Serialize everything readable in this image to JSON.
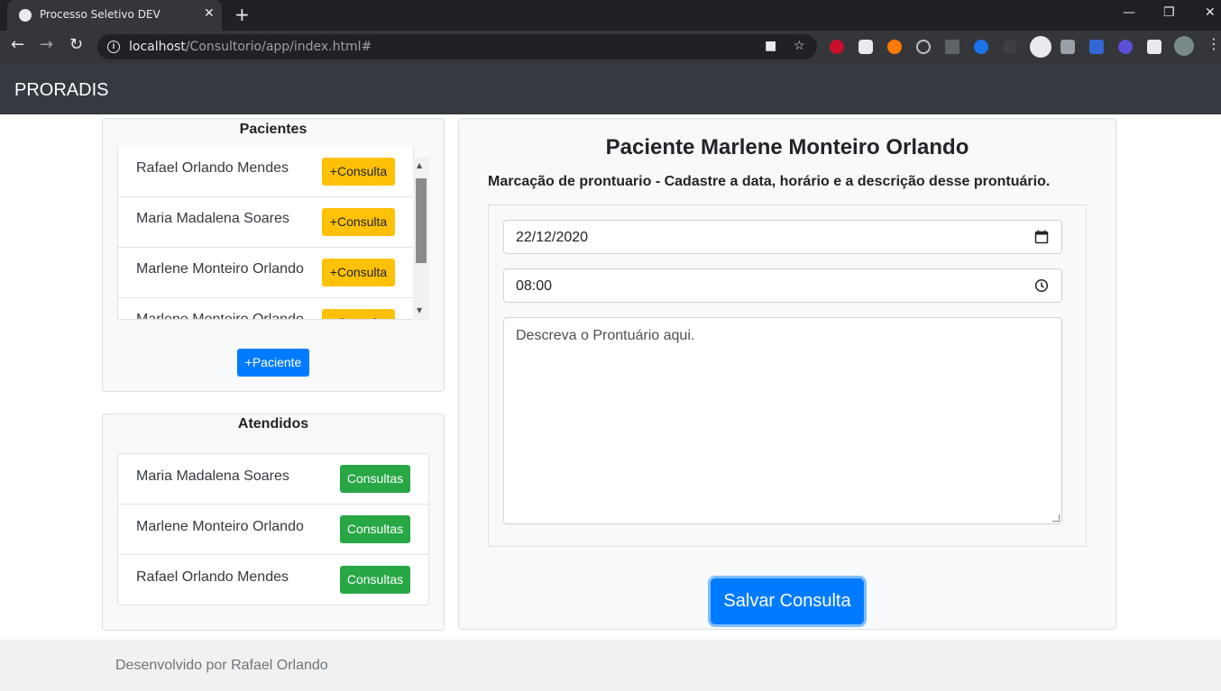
{
  "browser": {
    "tab_title": "Processo Seletivo DEV",
    "tab_close": "✕",
    "new_tab": "+",
    "url_host": "localhost",
    "url_path": "/Consultorio/app/index.html#",
    "nav_back": "←",
    "nav_forward": "→",
    "nav_reload": "↻",
    "win_minimize": "—",
    "win_restore": "❐",
    "win_close": "✕",
    "camera_icon": "■",
    "star_icon": "☆",
    "menu_icon": "⋮"
  },
  "navbar": {
    "brand": "PRORADIS"
  },
  "pacientes": {
    "title": "Pacientes",
    "items": [
      {
        "name": "Rafael Orlando Mendes",
        "action": "+Consulta"
      },
      {
        "name": "Maria Madalena Soares",
        "action": "+Consulta"
      },
      {
        "name": "Marlene Monteiro Orlando",
        "action": "+Consulta"
      },
      {
        "name": "Marlene Monteiro Orlando",
        "action": "+Consulta"
      }
    ],
    "add_button": "+Paciente"
  },
  "atendidos": {
    "title": "Atendidos",
    "items": [
      {
        "name": "Maria Madalena Soares",
        "action": "Consultas"
      },
      {
        "name": "Marlene Monteiro Orlando",
        "action": "Consultas"
      },
      {
        "name": "Rafael Orlando Mendes",
        "action": "Consultas"
      }
    ]
  },
  "form": {
    "title": "Paciente Marlene Monteiro Orlando",
    "subtitle": "Marcação de prontuario - Cadastre a data, horário e a descrição desse prontuário.",
    "date_value": "22/12/2020",
    "time_value": "08:00",
    "description_placeholder": "Descreva o Prontuário aqui.",
    "save_button": "Salvar Consulta"
  },
  "footer": {
    "text": "Desenvolvido por Rafael Orlando"
  }
}
